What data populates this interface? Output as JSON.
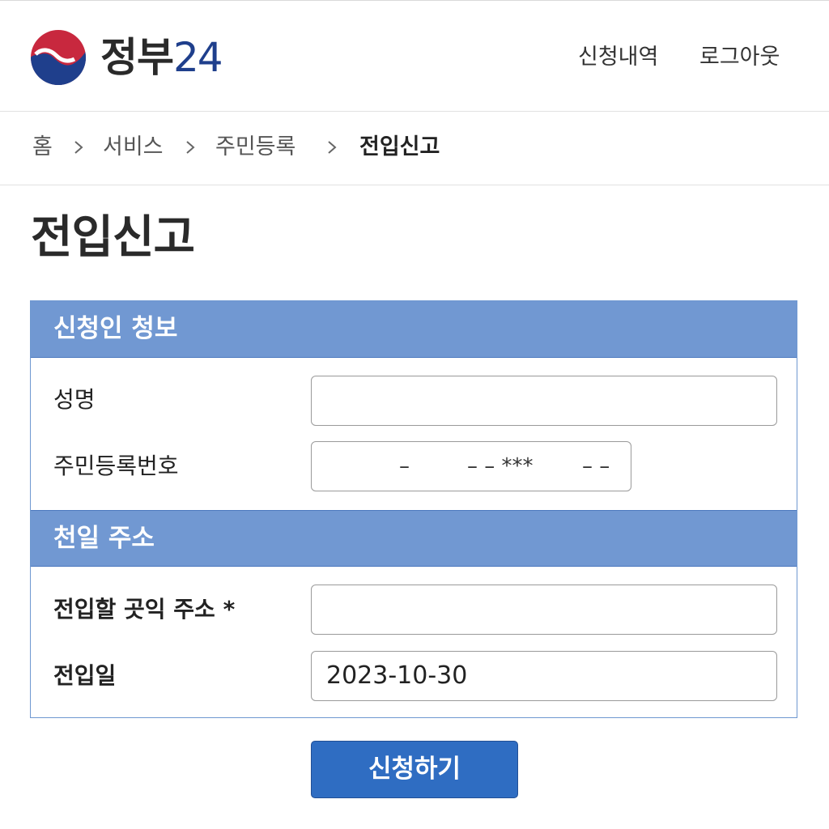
{
  "header": {
    "logo_text_ko": "정부",
    "logo_text_num": "24",
    "nav": {
      "history_label": "신청내역",
      "logout_label": "로그아웃"
    }
  },
  "breadcrumb": {
    "items": [
      "홈",
      "서비스",
      "주민등록",
      "전입신고"
    ],
    "separator": ">"
  },
  "page": {
    "title": "전입신고"
  },
  "form": {
    "applicant_section": {
      "title": "신청인 청보",
      "name_label": "성명",
      "name_value": "",
      "rrn_label": "주민등록번호",
      "rrn_mask_1": "–",
      "rrn_mask_2": "– – ***",
      "rrn_mask_3": "– –"
    },
    "address_section": {
      "title": "천일 주소",
      "address_label": "전입할 곳익 주소 *",
      "address_value": "",
      "date_label": "전입일",
      "date_value": "2023-10-30"
    },
    "submit_label": "신청하기"
  },
  "colors": {
    "section_header_bg": "#7198d2",
    "primary_button": "#2f6dc2",
    "logo_red": "#c8283e",
    "logo_blue": "#1f3f8c"
  },
  "icons": {
    "logo": "taegeuk-emblem-icon",
    "breadcrumb_separator": "chevron-right-icon"
  }
}
